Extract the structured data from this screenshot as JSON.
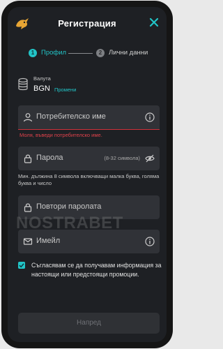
{
  "header": {
    "title": "Регистрация"
  },
  "steps": [
    {
      "number": "1",
      "label": "Профил"
    },
    {
      "number": "2",
      "label": "Лични данни"
    }
  ],
  "currency": {
    "label": "Валута",
    "value": "BGN",
    "change_label": "Промени"
  },
  "fields": {
    "username": {
      "placeholder": "Потребителско име",
      "error": "Моля, въведи потребителско име."
    },
    "password": {
      "placeholder": "Парола",
      "hint": "(8-32 символа)",
      "help": "Мин. дължина 8 символа включващи малка буква, голяма буква и число"
    },
    "password_repeat": {
      "placeholder": "Повтори паролата"
    },
    "email": {
      "placeholder": "Имейл"
    }
  },
  "watermark": "NOSTRABET",
  "consent": {
    "checked": true,
    "text": "Съгласявам се да получавам информация за настоящи или предстоящи промоции."
  },
  "submit": {
    "label": "Напред"
  },
  "colors": {
    "accent": "#22c4c7",
    "error": "#e0424b",
    "background": "#1e2024",
    "field": "#303237"
  }
}
